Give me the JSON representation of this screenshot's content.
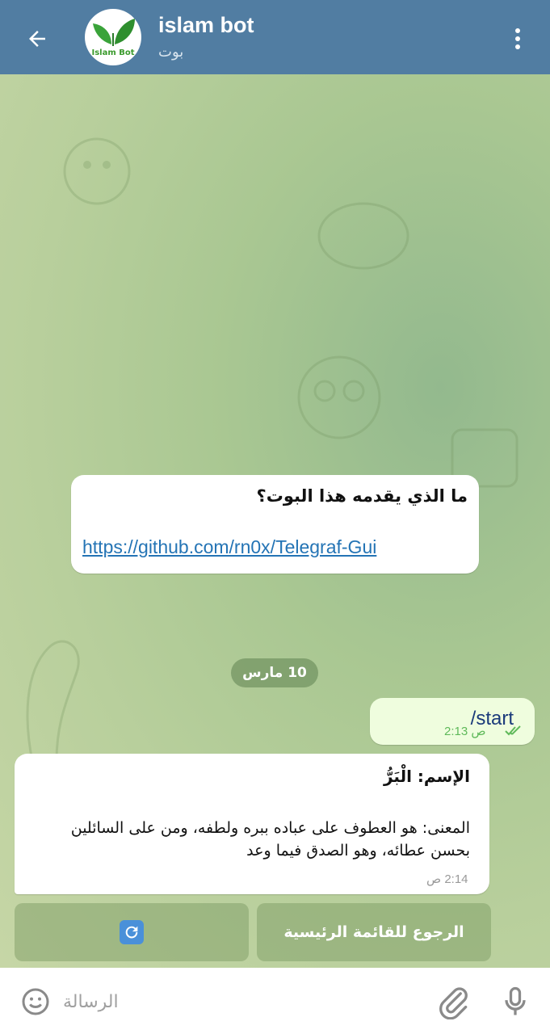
{
  "header": {
    "title": "islam bot",
    "subtitle": "بوت",
    "avatar_text": "Islam Bot"
  },
  "messages": {
    "intro": {
      "title": "ما الذي يقدمه هذا البوت؟",
      "link": "https://github.com/rn0x/Telegraf-Gui"
    },
    "date_chip": "10 مارس",
    "outgoing": {
      "text": "/start",
      "time": "2:13 ص"
    },
    "name_card": {
      "title": "الإسم: الْبَرُّ",
      "body": "المعنى: هو العطوف على عباده ببره ولطفه، ومن على السائلين بحسن عطائه، وهو الصدق فيما وعد",
      "time": "2:14 ص"
    }
  },
  "keyboard": {
    "home_label": "الرجوع للقائمة الرئيسية"
  },
  "input": {
    "placeholder": "الرسالة"
  },
  "colors": {
    "header": "#517da2",
    "outgoing_bubble": "#effdde",
    "link": "#2474b5",
    "check": "#5fb95a"
  },
  "icons": [
    "back-arrow-icon",
    "more-vert-icon",
    "double-check-icon",
    "refresh-icon",
    "emoji-icon",
    "paperclip-icon",
    "microphone-icon"
  ]
}
